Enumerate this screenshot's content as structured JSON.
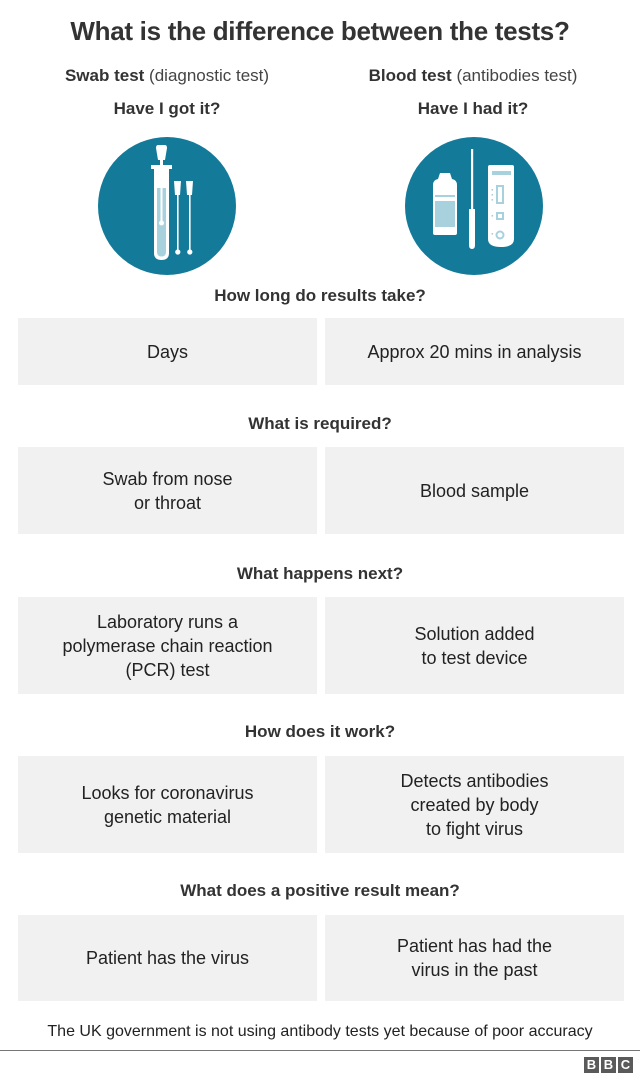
{
  "title": "What is the difference between the tests?",
  "columns": [
    {
      "name": "Swab test",
      "subtitle": "(diagnostic test)",
      "question": "Have I got it?",
      "icon": "swab-test-tube-icon"
    },
    {
      "name": "Blood test",
      "subtitle": "(antibodies test)",
      "question": "Have I had it?",
      "icon": "blood-test-kit-icon"
    }
  ],
  "colors": {
    "icon_circle": "#137a9a",
    "cell_bg": "#f1f1f1",
    "icon_fill": "#ffffff",
    "icon_light": "#a8d1de"
  },
  "sections": [
    {
      "heading": "How long do results take?",
      "swab": "Days",
      "blood": "Approx 20 mins in analysis"
    },
    {
      "heading": "What is required?",
      "swab": "Swab from nose\nor throat",
      "blood": "Blood sample"
    },
    {
      "heading": "What happens next?",
      "swab": "Laboratory runs a\npolymerase chain reaction\n(PCR) test",
      "blood": "Solution added\nto test device"
    },
    {
      "heading": "How does it work?",
      "swab": "Looks for coronavirus\ngenetic material",
      "blood": "Detects antibodies\ncreated by body\nto fight virus"
    },
    {
      "heading": "What does a positive result mean?",
      "swab": "Patient has the virus",
      "blood": "Patient has had the\nvirus in the past"
    }
  ],
  "footnote": "The UK government is not using antibody tests yet because of poor accuracy",
  "logo": {
    "letters": [
      "B",
      "B",
      "C"
    ],
    "name": "bbc-logo"
  }
}
